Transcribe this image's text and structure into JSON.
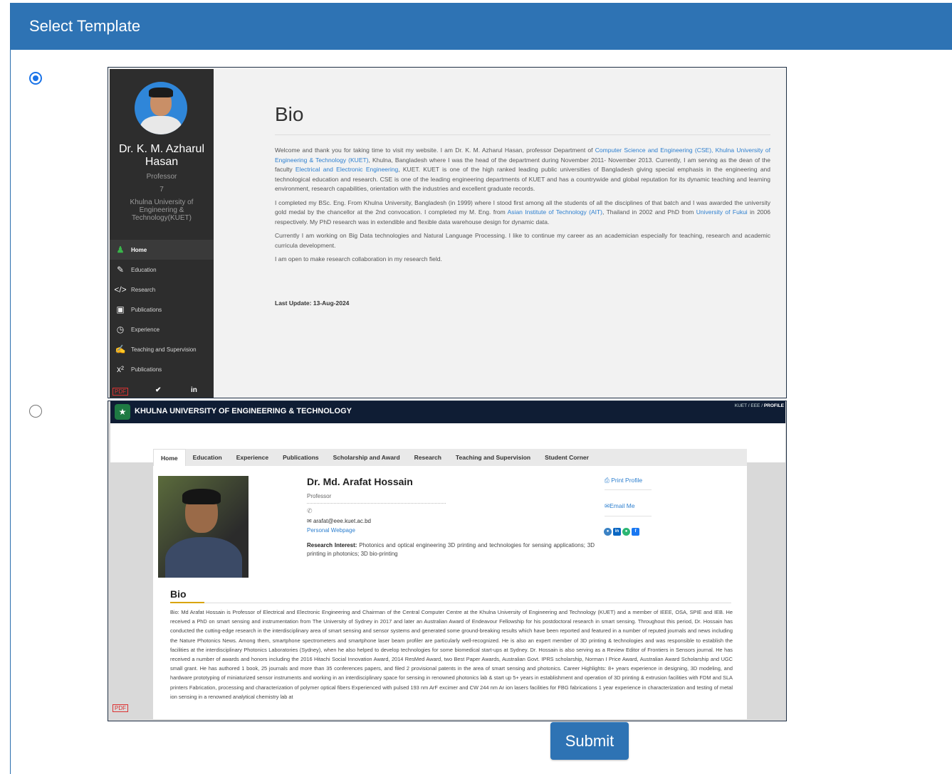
{
  "header": {
    "title": "Select Template"
  },
  "templates": [
    {
      "selected": true,
      "name": "Dr. K. M. Azharul Hasan",
      "position": "Professor",
      "number": "7",
      "institution": "Khulna University of Engineering & Technology(KUET)",
      "menu": [
        "Home",
        "Education",
        "Research",
        "Publications",
        "Experience",
        "Teaching and Supervision",
        "Publications"
      ],
      "bio_heading": "Bio",
      "bio_p1_a": "Welcome and thank you for taking time to visit my website. I am Dr. K. M. Azharul Hasan, professor Department of ",
      "bio_p1_link1": "Computer Science and Engineering (CSE), Khulna University of Engineering & Technology (KUET)",
      "bio_p1_b": ", Khulna, Bangladesh where I was the head of the department during November 2011- November 2013. Currently, I am serving as the dean of the faculty ",
      "bio_p1_link2": "Electrical and Electronic Engineering",
      "bio_p1_c": ", KUET. KUET is one of the high ranked leading public universities of Bangladesh giving special emphasis in the engineering and technological education and research. CSE is one of the leading engineering departments of KUET and has a countrywide and global reputation for its dynamic teaching and learning environment, research capabilities, orientation with the industries and excellent graduate records.",
      "bio_p2_a": "I completed my BSc. Eng. From Khulna University, Bangladesh (in 1999) where I stood first among all the students of all the disciplines of that batch and I was awarded the university gold medal by the chancellor at the 2nd convocation. I completed my M. Eng. from ",
      "bio_p2_link1": "Asian Institute of Technology (AIT)",
      "bio_p2_b": ", Thailand in 2002 and PhD from ",
      "bio_p2_link2": "University of Fukui",
      "bio_p2_c": " in 2006 respectively. My PhD research was in extendible and flexible data warehouse design for dynamic data.",
      "bio_p3": "Currently I am working on Big Data technologies and Natural Language Processing. I like to continue my career as an academician especially for teaching, research and academic curricula development.",
      "bio_p4": "I am open to make research collaboration in my research field.",
      "last_update_label": "Last Update:",
      "last_update_value": "13-Aug-2024",
      "social": [
        "✔",
        "in"
      ]
    },
    {
      "selected": false,
      "university": "KHULNA UNIVERSITY OF ENGINEERING & TECHNOLOGY",
      "breadcrumb": "KUET / EEE /",
      "breadcrumb_current": "PROFILE",
      "nav": [
        "Home",
        "Education",
        "Experience",
        "Publications",
        "Scholarship and Award",
        "Research",
        "Teaching and Supervision",
        "Student Corner"
      ],
      "name": "Dr. Md. Arafat Hossain",
      "position": "Professor",
      "email": "arafat@eee.kuet.ac.bd",
      "webpage": "Personal Webpage",
      "research_label": "Research Interest:",
      "research_text": "Photonics and optical engineering 3D printing and technologies for sensing applications; 3D printing in photonics; 3D bio-printing",
      "print_profile": "Print Profile",
      "email_me": "Email Me",
      "bio_heading": "Bio",
      "bio_text": "Bio: Md Arafat Hossain is Professor of Electrical and Electronic Engineering and Chairman of the Central Computer Centre at the Khulna University of Engineering and Technology (KUET) and a member of IEEE, OSA, SPIE and IEB. He received a PhD on smart sensing and instrumentation from The University of Sydney in 2017 and later an Australian Award of Endeavour Fellowship for his postdoctoral research in smart sensing. Throughout this period, Dr. Hossain has conducted the cutting-edge research in the interdisciplinary area of smart sensing and sensor systems and generated some ground-breaking results which have been reported and featured in a number of reputed journals and news including the Nature Photonics News. Among them, smartphone spectrometers and smartphone laser beam profiler are particularly well-recognized. He is also an expert member of 3D printing & technologies and was responsible to establish the facilities at the interdisciplinary Photonics Laboratories (Sydney), when he also helped to develop technologies for some biomedical start-ups at Sydney. Dr. Hossain is also serving as a Review Editor of Frontiers in Sensors journal. He has received a number of awards and honors including the 2016 Hitachi Social Innovation Award, 2014 ResMed Award, two Best Paper Awards, Australian Govt. IPRS scholarship, Norman I Price Award, Australian Award Scholarship and UGC small grant. He has authored 1 book, 25 journals and more than 35 conferences papers, and filed 2 provisional patents in the area of smart sensing and photonics. Career Highlights: 8+ years experience in designing, 3D modeling, and hardware prototyping of miniaturized sensor instruments and working in an interdisciplinary space for sensing in renowned photonics lab & start up 5+ years in establishment and operation of 3D printing & extrusion facilities with FDM and SLA printers Fabrication, processing and characterization of polymer optical fibers Experienced with pulsed 193 nm ArF excimer and CW 244 nm Ar ion lasers facilities for FBG fabrications 1 year experience in characterization and testing of metal ion sensing in a renowned analytical chemistry lab at"
    }
  ],
  "submit": {
    "label": "Submit"
  },
  "colors": {
    "header_bg": "#2e73b4",
    "link": "#2d7fcf",
    "radio": "#1a73e8"
  }
}
